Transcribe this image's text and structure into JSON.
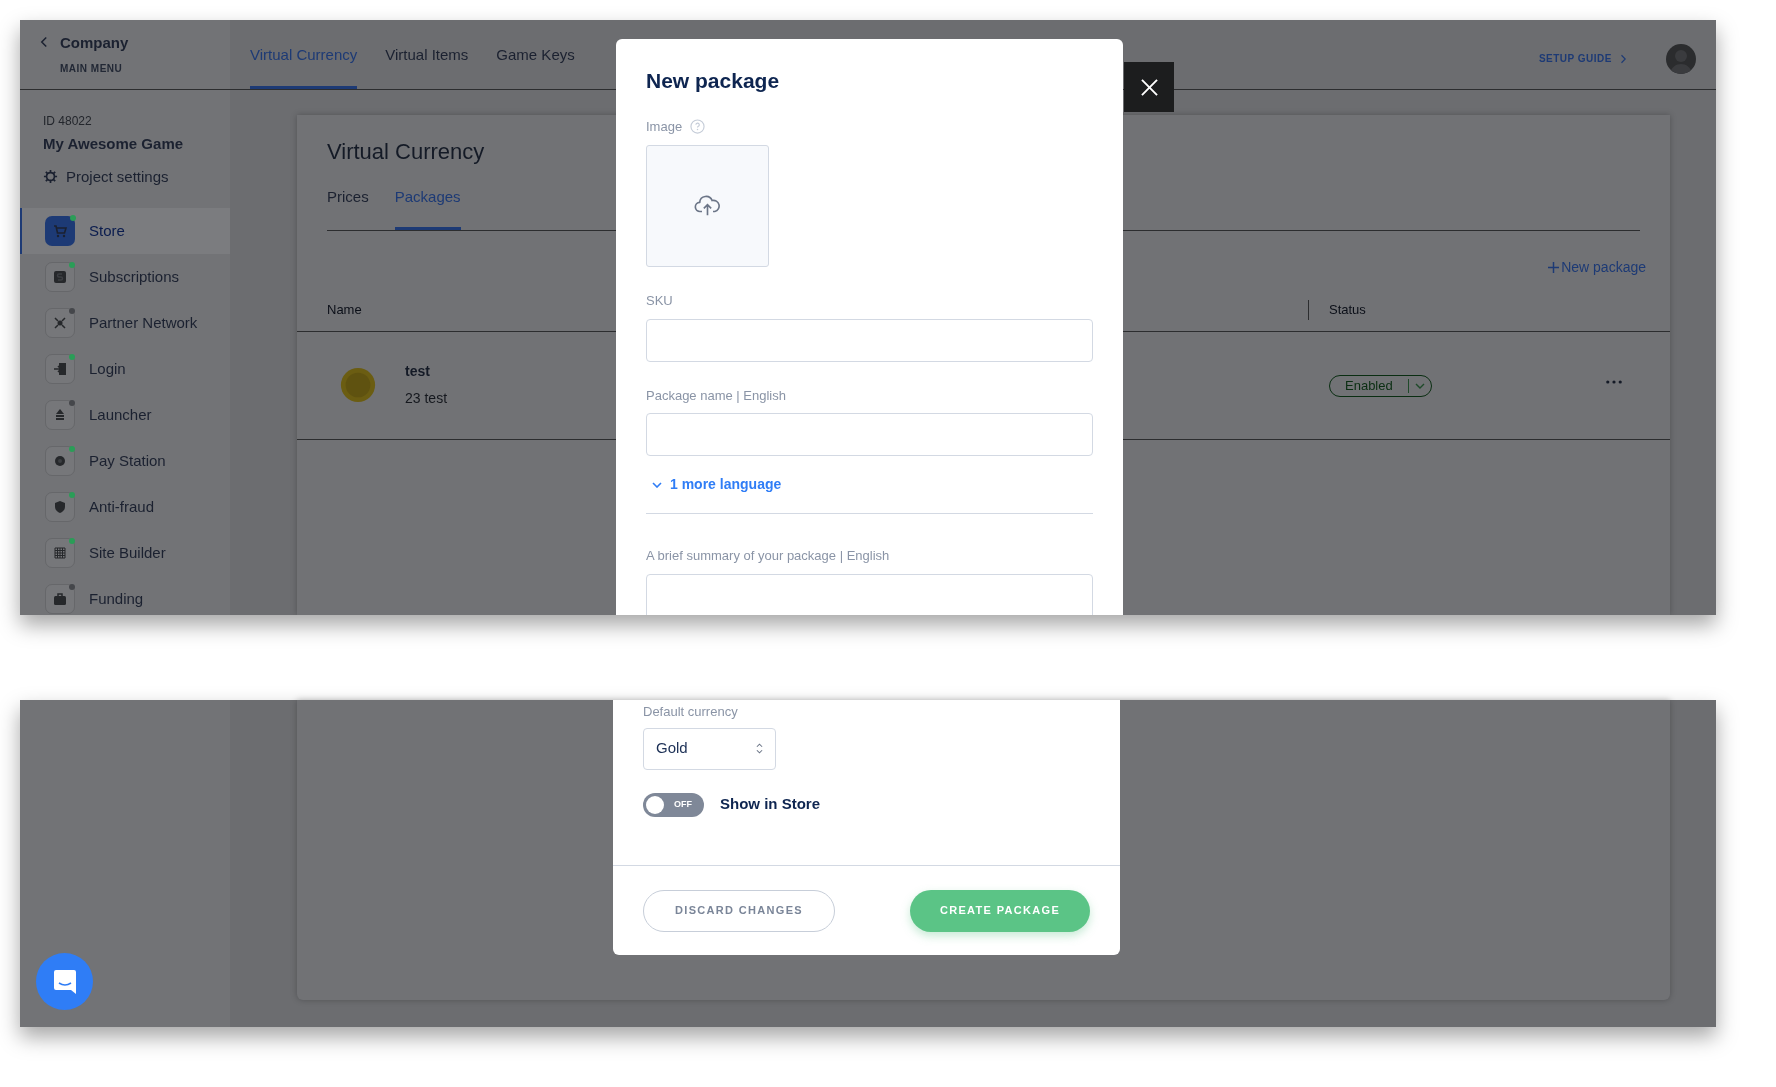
{
  "sidebar": {
    "back_label": "Company",
    "subtitle": "MAIN MENU",
    "project_id": "ID 48022",
    "project_name": "My Awesome Game",
    "settings_label": "Project settings",
    "items": [
      {
        "label": "Store",
        "selected": true,
        "color": "#2a9d57"
      },
      {
        "label": "Subscriptions",
        "selected": false,
        "color": "#2a9d57"
      },
      {
        "label": "Partner Network",
        "selected": false,
        "color": "#45474b"
      },
      {
        "label": "Login",
        "selected": false,
        "color": "#2a9d57"
      },
      {
        "label": "Launcher",
        "selected": false,
        "color": "#45474b"
      },
      {
        "label": "Pay Station",
        "selected": false,
        "color": "#2a9d57"
      },
      {
        "label": "Anti-fraud",
        "selected": false,
        "color": "#2a9d57"
      },
      {
        "label": "Site Builder",
        "selected": false,
        "color": "#2a9d57"
      },
      {
        "label": "Funding",
        "selected": false,
        "color": "#45474b"
      }
    ]
  },
  "top_nav": {
    "tabs": [
      {
        "label": "Virtual Currency",
        "selected": true
      },
      {
        "label": "Virtual Items",
        "selected": false
      },
      {
        "label": "Game Keys",
        "selected": false
      }
    ],
    "setup_guide": "SETUP GUIDE"
  },
  "page": {
    "title": "Virtual Currency",
    "tabs": [
      {
        "label": "Prices",
        "selected": false
      },
      {
        "label": "Packages",
        "selected": true
      }
    ],
    "new_package": "New package",
    "table": {
      "columns": [
        "Name",
        "Status"
      ],
      "rows": [
        {
          "name": "test",
          "description": "23 test",
          "status": "Enabled"
        }
      ]
    }
  },
  "modal": {
    "title": "New package",
    "image_label": "Image",
    "sku_label": "SKU",
    "package_name_label": "Package name | English",
    "more_languages": "1 more language",
    "summary_label": "A brief summary of your package | English",
    "default_currency_label": "Default currency",
    "currency_value": "Gold",
    "show_in_store": {
      "label": "Show in Store",
      "on": false,
      "state_text": "OFF"
    },
    "discard_button": "DISCARD CHANGES",
    "create_button": "CREATE PACKAGE"
  }
}
